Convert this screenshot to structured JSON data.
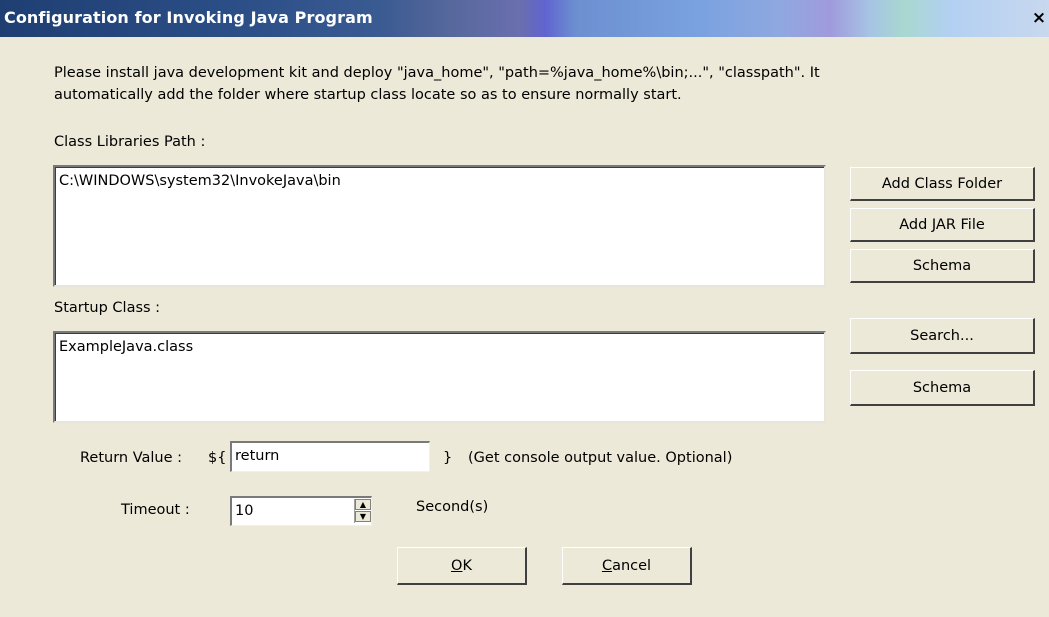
{
  "window": {
    "title": "Configuration for Invoking Java Program",
    "close_glyph": "×"
  },
  "instructions": {
    "line1": "Please install java development kit and deploy \"java_home\", \"path=%java_home%\\bin;...\", \"classpath\". It",
    "line2": "automatically add the folder where startup class locate so as to ensure normally start."
  },
  "class_libraries": {
    "label": "Class Libraries Path :",
    "value": "C:\\WINDOWS\\system32\\InvokeJava\\bin",
    "add_class_folder_label": "Add Class Folder",
    "add_jar_file_label": "Add JAR File",
    "schema_label": "Schema"
  },
  "startup_class": {
    "label": "Startup Class :",
    "value": "ExampleJava.class",
    "search_label": "Search...",
    "schema_label": "Schema"
  },
  "return_value": {
    "label": "Return Value :",
    "prefix": "${",
    "value": "return",
    "suffix": "}",
    "hint": "(Get console output value. Optional)"
  },
  "timeout": {
    "label": "Timeout :",
    "value": "10",
    "unit": "Second(s)"
  },
  "buttons": {
    "ok_mnemonic": "O",
    "ok_rest": "K",
    "cancel_mnemonic": "C",
    "cancel_rest": "ancel"
  },
  "icons": {
    "close": "close-icon",
    "spin_up": "spin-up-icon",
    "spin_down": "spin-down-icon"
  }
}
